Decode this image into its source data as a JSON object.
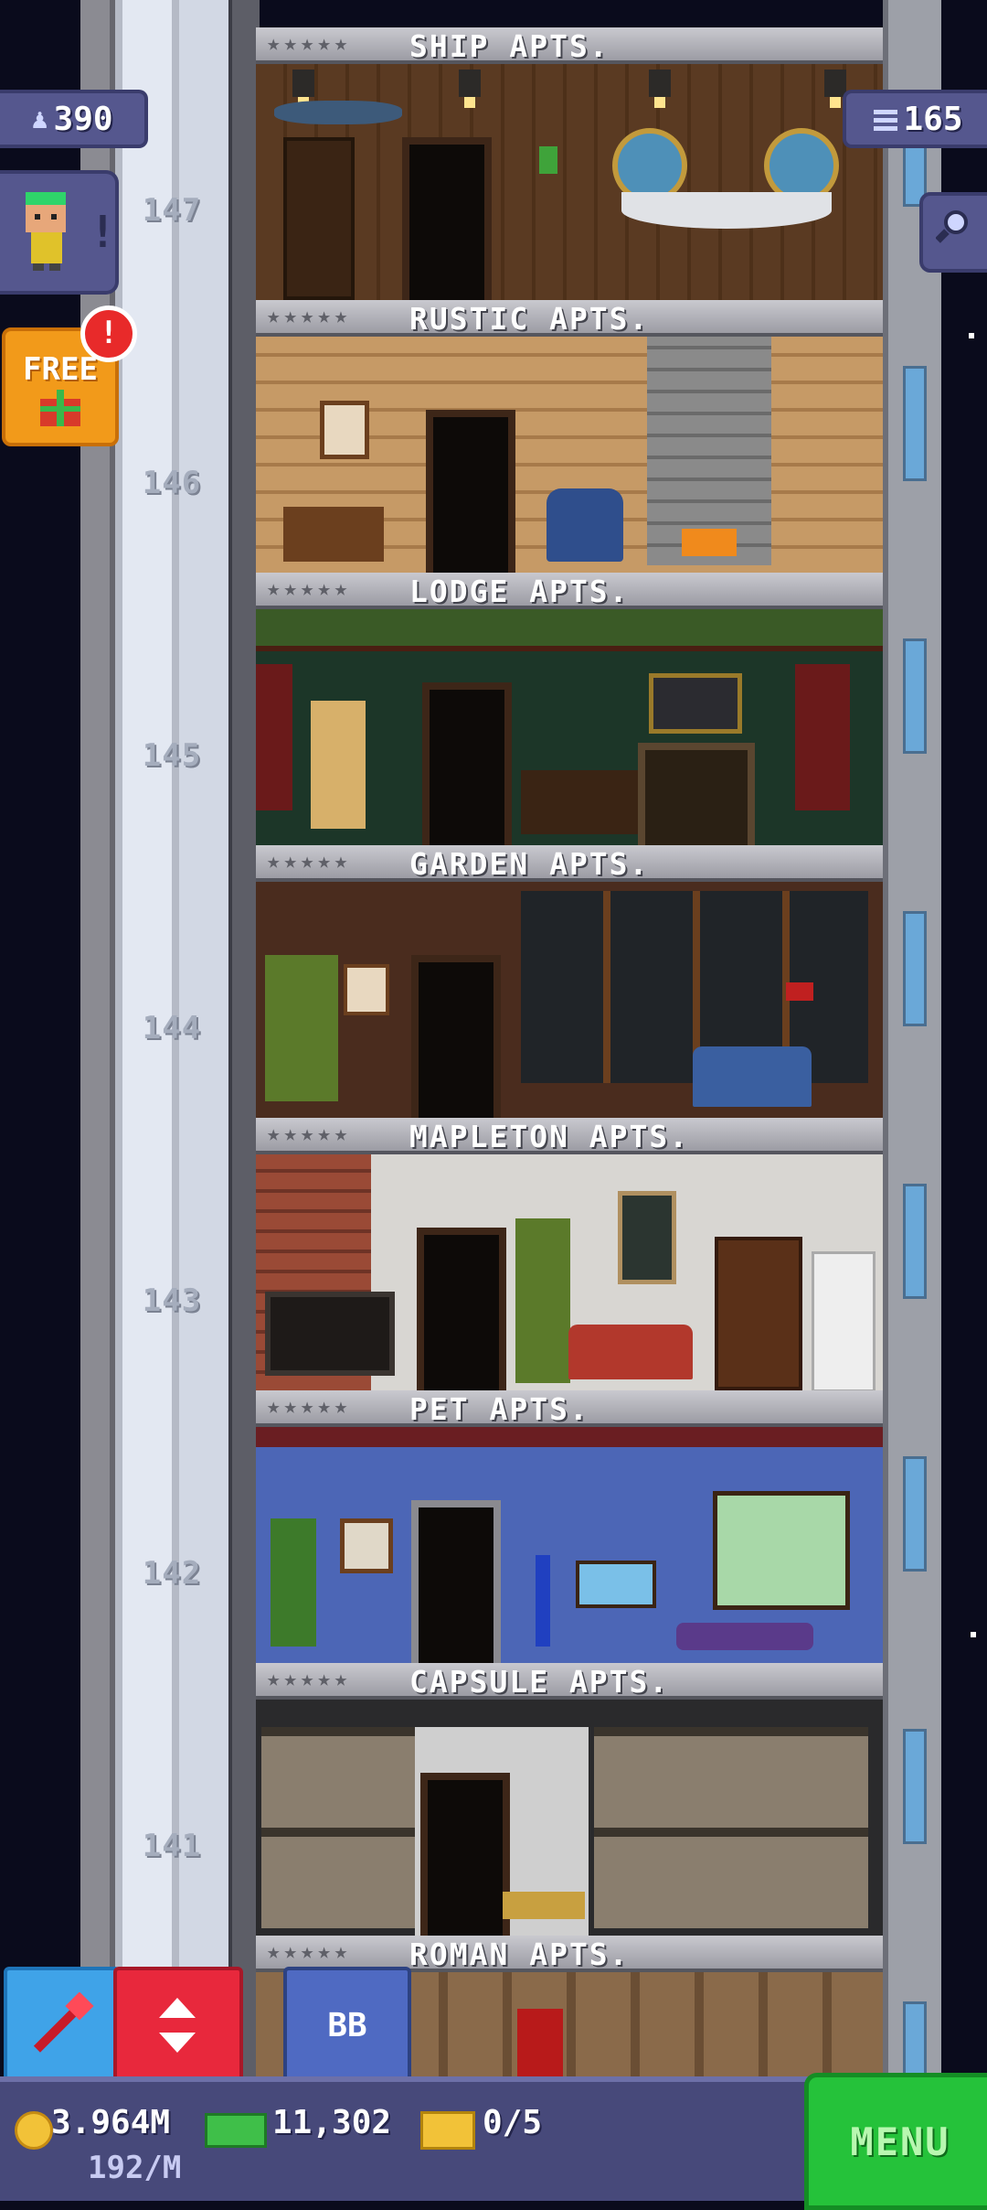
{
  "hud": {
    "population": "390",
    "floors": "165",
    "gift_label": "FREE",
    "gift_badge": "!",
    "bitizen_alert": "!"
  },
  "floor_numbers": [
    "147",
    "146",
    "145",
    "144",
    "143",
    "142",
    "141"
  ],
  "floors": [
    {
      "name": "SHIP APTS.",
      "stars": "★★★★★"
    },
    {
      "name": "RUSTIC APTS.",
      "stars": "★★★★★"
    },
    {
      "name": "LODGE APTS.",
      "stars": "★★★★★"
    },
    {
      "name": "GARDEN APTS.",
      "stars": "★★★★★"
    },
    {
      "name": "MAPLETON APTS.",
      "stars": "★★★★★"
    },
    {
      "name": "PET APTS.",
      "stars": "★★★★★"
    },
    {
      "name": "CAPSULE APTS.",
      "stars": "★★★★★"
    },
    {
      "name": "ROMAN APTS.",
      "stars": "★★★★★"
    }
  ],
  "bottom_bar": {
    "coins": "3.964M",
    "bux": "11,302",
    "tickets": "0/5",
    "income": "192/M",
    "menu_label": "MENU",
    "bb_label": "BB"
  },
  "icons": {
    "population": "person-icon",
    "floors": "building-icon",
    "search": "magnifier-icon",
    "gift": "gift-icon",
    "raffle": "raffle-arrow-icon",
    "elevator": "elevator-arrows-icon"
  }
}
